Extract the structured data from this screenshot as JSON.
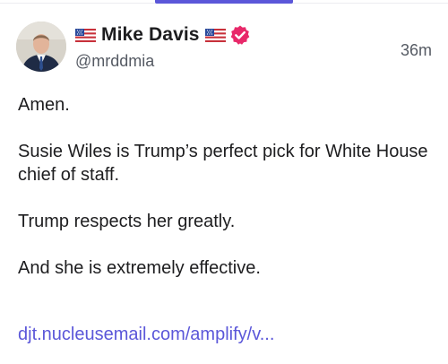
{
  "post": {
    "author": {
      "display_name": "Mike Davis",
      "handle": "@mrddmia",
      "verified": true,
      "flag_icon": "us-flag-icon",
      "verified_icon": "verified-badge-icon"
    },
    "timestamp": "36m",
    "paragraphs": [
      "Amen.",
      "Susie Wiles is Trump’s perfect pick for White House chief of staff.",
      "Trump respects her greatly.",
      "And she is extremely effective."
    ],
    "link_text": "djt.nucleusemail.com/amplify/v..."
  },
  "colors": {
    "accent": "#5b57d9",
    "verified_badge": "#e8296a",
    "text": "#1d1d1f",
    "muted": "#555a63"
  }
}
